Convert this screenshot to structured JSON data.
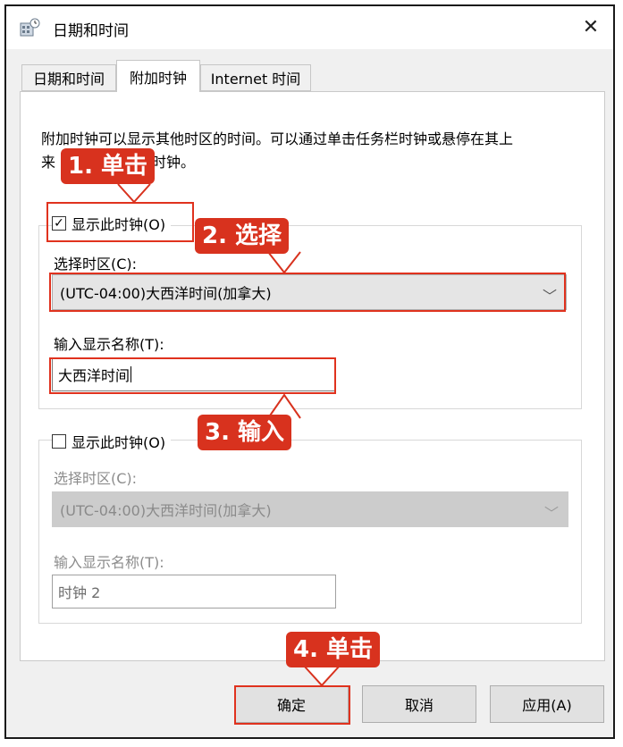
{
  "window": {
    "title": "日期和时间",
    "close_symbol": "✕"
  },
  "tabs": [
    {
      "label": "日期和时间"
    },
    {
      "label": "附加时钟"
    },
    {
      "label": "Internet 时间"
    }
  ],
  "description": "附加时钟可以显示其他时区的时间。可以通过单击任务栏时钟或悬停在其上来查看这些附加时钟。",
  "description_visible": {
    "line1": "附加时钟可以显示其他时区的时间。可以通过单击任务栏时钟或悬停在其上",
    "line2_start": "来",
    "line2_end": "时钟。"
  },
  "clock1": {
    "checkbox_label": "显示此时钟(O)",
    "checked": true,
    "timezone_label": "选择时区(C):",
    "timezone_value": "(UTC-04:00)大西洋时间(加拿大)",
    "name_label": "输入显示名称(T):",
    "name_value": "大西洋时间"
  },
  "clock2": {
    "checkbox_label": "显示此时钟(O)",
    "checked": false,
    "timezone_label": "选择时区(C):",
    "timezone_value": "(UTC-04:00)大西洋时间(加拿大)",
    "name_label": "输入显示名称(T):",
    "name_value": "时钟 2"
  },
  "buttons": {
    "ok": "确定",
    "cancel": "取消",
    "apply": "应用(A)"
  },
  "annotations": {
    "step1": "1. 单击",
    "step2": "2. 选择",
    "step3": "3. 输入",
    "step4": "4. 单击"
  },
  "colors": {
    "annotation_red": "#d8321e"
  }
}
